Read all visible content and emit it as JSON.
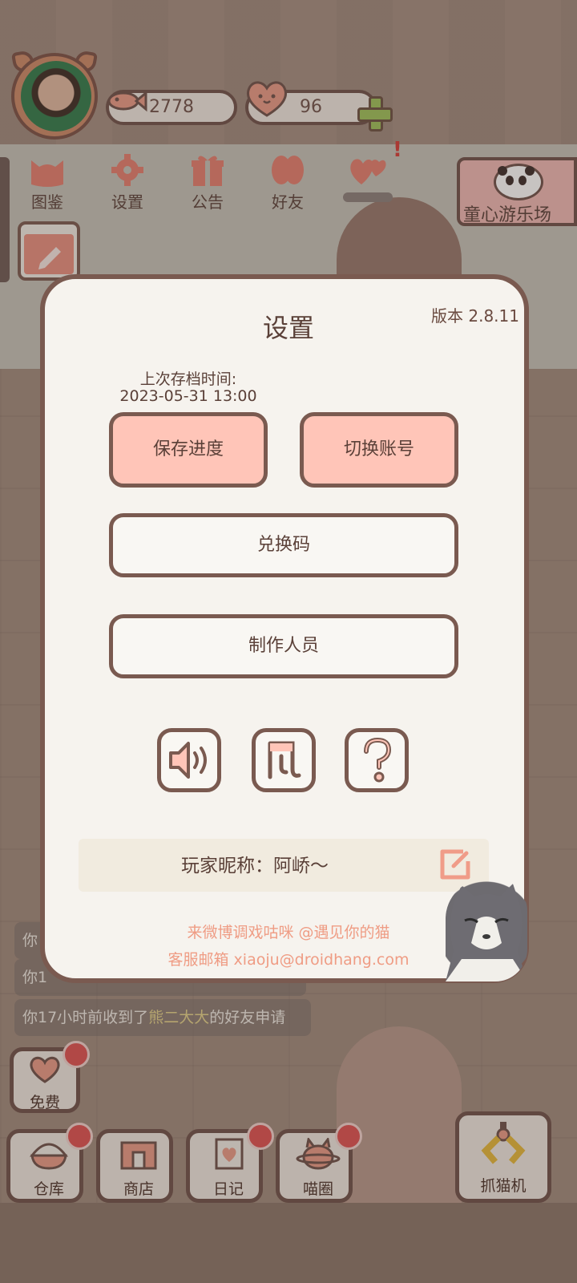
{
  "top_bar": {
    "coins": "2778",
    "hearts": "96",
    "coin_icon": "fish-icon",
    "heart_icon": "heart-face-icon"
  },
  "nav": [
    {
      "label": "图鉴",
      "icon": "cat-head-icon"
    },
    {
      "label": "设置",
      "icon": "gear-icon"
    },
    {
      "label": "公告",
      "icon": "gift-icon"
    },
    {
      "label": "好友",
      "icon": "friends-icon"
    },
    {
      "label": "",
      "icon": "hearts-icon"
    }
  ],
  "banner": {
    "label": "童心游乐场"
  },
  "dialog": {
    "title": "设置",
    "version": "版本 2.8.11",
    "last_save_label": "上次存档时间:",
    "last_save_value": "2023-05-31 13:00",
    "save_button": "保存进度",
    "switch_account_button": "切换账号",
    "redeem_button": "兑换码",
    "credits_button": "制作人员",
    "nickname_label": "玩家昵称：阿峤～",
    "weibo_line": "来微博调戏咕咪 @遇见你的猫",
    "email_line": "客服邮箱 xiaoju@droidhang.com"
  },
  "messages": {
    "partial_1": "你",
    "partial_2": "你1",
    "full_prefix": "你17小时前收到了",
    "full_name": "熊二大大",
    "full_suffix": "的好友申请"
  },
  "bottom": {
    "free": "免费",
    "storage": "仓库",
    "shop": "商店",
    "diary": "日记",
    "meow_circle": "喵圈",
    "claw_machine": "抓猫机"
  },
  "colors": {
    "accent_pink": "#ffc5b8",
    "border_brown": "#7a5a50",
    "footer_text": "#ef9c84",
    "badge_red": "#e05050"
  }
}
